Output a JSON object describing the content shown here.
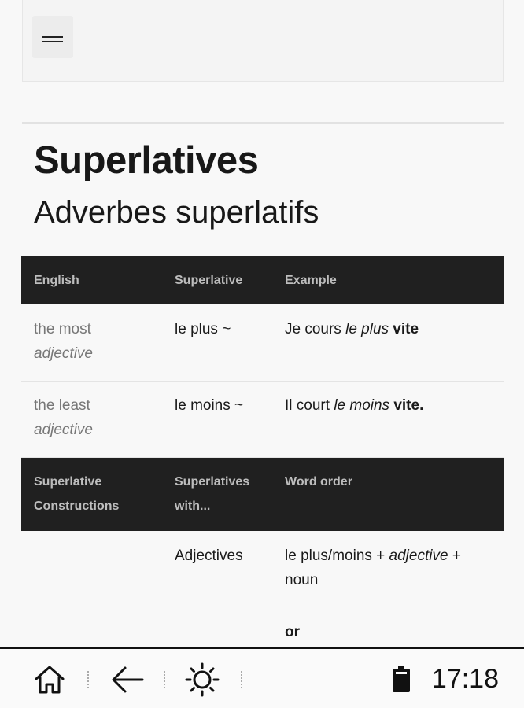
{
  "header": {
    "menu_icon": "hamburger-menu-icon"
  },
  "page": {
    "title": "Superlatives",
    "subtitle": "Adverbes superlatifs"
  },
  "table1": {
    "headers": [
      "English",
      "Superlative",
      "Example"
    ],
    "rows": [
      {
        "english_1": "the most",
        "english_2": "adjective",
        "superlative": "le plus ~",
        "ex_a": "Je cours ",
        "ex_b": "le plus",
        "ex_c": " vite"
      },
      {
        "english_1": "the least",
        "english_2": "adjective",
        "superlative": "le moins ~",
        "ex_a": "Il court ",
        "ex_b": "le moins",
        "ex_c": " vite."
      }
    ]
  },
  "table2": {
    "headers": [
      {
        "l1": "Superlative",
        "l2": "Constructions"
      },
      {
        "l1": "Superlatives",
        "l2": "with..."
      },
      {
        "l1": "Word order",
        "l2": ""
      }
    ],
    "rows": [
      {
        "with": "Adjectives",
        "order_a": "le plus/moins + ",
        "order_b": "adjective",
        "order_c": " +",
        "order_d": "noun"
      }
    ],
    "partial_row_text": "or"
  },
  "bottom_bar": {
    "icons": [
      "home-icon",
      "back-arrow-icon",
      "brightness-icon",
      "battery-icon"
    ],
    "time": "17:18"
  }
}
